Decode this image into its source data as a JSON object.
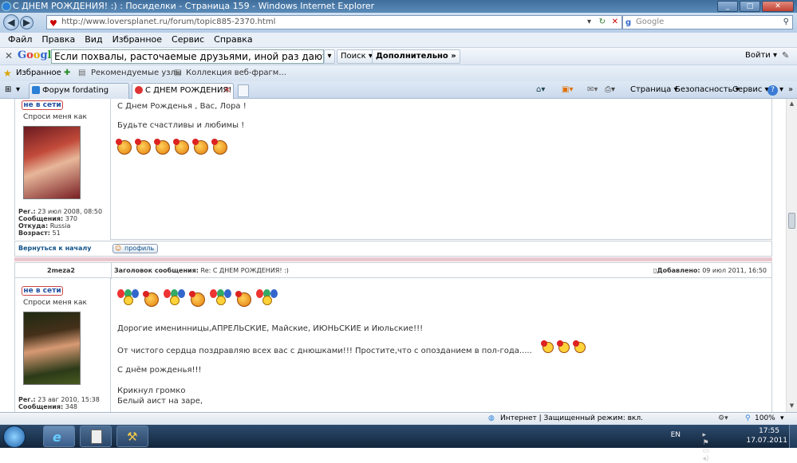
{
  "window": {
    "title": "С ДНЕМ РОЖДЕНИЯ! :) : Посиделки - Страница 159 - Windows Internet Explorer"
  },
  "address": {
    "url": "http://www.loversplanet.ru/forum/topic885-2370.html",
    "search_placeholder": "Google"
  },
  "menu": [
    "Файл",
    "Правка",
    "Вид",
    "Избранное",
    "Сервис",
    "Справка"
  ],
  "google_toolbar": {
    "logo": "Google",
    "query": "Если похвалы, расточаемые друзьями, иной раз дают повод у",
    "search_btn": "Поиск",
    "more_btn": "Дополнительно",
    "login": "Войти"
  },
  "favorites": {
    "label": "Избранное",
    "items": [
      "Рекомендуемые узлы",
      "Коллекция веб-фрагм..."
    ]
  },
  "tabs": [
    {
      "label": "Форум fordating",
      "active": false
    },
    {
      "label": "С ДНЕМ РОЖДЕНИЯ! :...",
      "active": true
    }
  ],
  "commands": [
    "Страница",
    "Безопасность",
    "Сервис"
  ],
  "post1": {
    "status": "не в сети",
    "ask": "Спроси меня как",
    "reg": "Рег.:",
    "reg_val": "23 июл 2008, 08:50",
    "msgs": "Сообщения:",
    "msgs_val": "370",
    "from": "Откуда:",
    "from_val": "Russia",
    "age": "Возраст:",
    "age_val": "51",
    "line1": "С Днем Рожденья , Вас, Лора !",
    "line2": "Будьте счастливы и любимы !",
    "back": "Вернуться к началу",
    "profile": "профиль"
  },
  "post2": {
    "author": "2meza2",
    "subject_label": "Заголовок сообщения:",
    "subject": "Re: С ДНЕМ РОЖДЕНИЯ! :)",
    "added_label": "Добавлено:",
    "added": "09 июл 2011, 16:50",
    "status": "не в сети",
    "ask": "Спроси меня как",
    "reg": "Рег.:",
    "reg_val": "23 авг 2010, 15:38",
    "msgs": "Сообщения:",
    "msgs_val": "348",
    "line1": "Дорогие именинницы,АПРЕЛЬСКИЕ, Майские, ИЮНЬСКИЕ и Июльские!!!",
    "line2": "От чистого сердца поздравляю всех вас с днюшками!!! Простите,что с опозданием в пол-года.....",
    "line3": "С днём рожденья!!!",
    "line4": "Крикнул громко",
    "line5": "Белый аист на заре,"
  },
  "status": {
    "zone": "Интернет | Защищенный режим: вкл.",
    "zoom": "100%"
  },
  "taskbar": {
    "lang": "EN",
    "time": "17:55",
    "date": "17.07.2011"
  }
}
